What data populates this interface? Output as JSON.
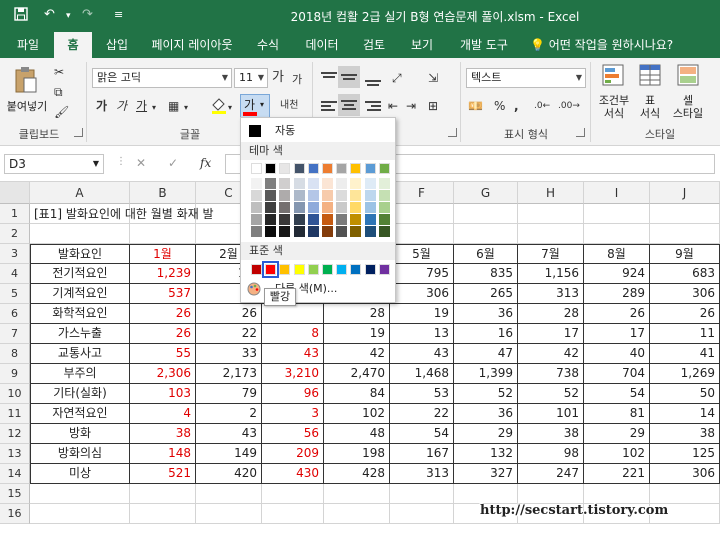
{
  "app": {
    "title": "2018년 컴활 2급 실기 B형 연습문제 풀이.xlsm  -  Excel",
    "brand_color": "#217346"
  },
  "quick_access": {
    "save_icon": "save-icon",
    "undo_icon": "undo-icon",
    "redo_icon": "redo-icon",
    "customize_icon": "customize-icon"
  },
  "tabs": [
    {
      "label": "파일"
    },
    {
      "label": "홈"
    },
    {
      "label": "삽입"
    },
    {
      "label": "페이지 레이아웃"
    },
    {
      "label": "수식"
    },
    {
      "label": "데이터"
    },
    {
      "label": "검토"
    },
    {
      "label": "보기"
    },
    {
      "label": "개발 도구"
    }
  ],
  "tell_me": "어떤 작업을 원하시나요?",
  "ribbon": {
    "clipboard": {
      "paste_label": "붙여넣기",
      "group_label": "클립보드"
    },
    "font": {
      "font_name": "맑은 고딕",
      "font_size": "11",
      "bold": "가",
      "italic": "가",
      "underline": "가",
      "grow": "가",
      "shrink": "가",
      "color_btn": "가",
      "phonetic": "내천",
      "group_label": "글꼴"
    },
    "alignment": {
      "group_label": ""
    },
    "number": {
      "format": "텍스트",
      "group_label": "표시 형식"
    },
    "styles": {
      "conditional": "조건부\n서식",
      "table": "표\n서식",
      "cell": "셀\n스타일",
      "group_label": "스타일"
    }
  },
  "formula_bar": {
    "name_box": "D3",
    "cancel": "✕",
    "enter": "✓",
    "fx": "fx",
    "content": ""
  },
  "columns": [
    "A",
    "B",
    "C",
    "D",
    "E",
    "F",
    "G",
    "H",
    "I",
    "J"
  ],
  "rows": [
    {
      "n": "1",
      "cells": [
        "",
        "",
        "",
        "",
        "",
        "",
        "",
        "",
        "",
        ""
      ]
    },
    {
      "n": "2",
      "cells": [
        "",
        "",
        "",
        "",
        "",
        "",
        "",
        "",
        "",
        ""
      ]
    },
    {
      "n": "3",
      "cells": [
        "발화요인",
        "1월",
        "2월",
        "",
        "",
        "5월",
        "6월",
        "7월",
        "8월",
        "9월"
      ]
    },
    {
      "n": "4",
      "cells": [
        "전기적요인",
        "1,239",
        "1,0",
        "",
        "",
        "795",
        "835",
        "1,156",
        "924",
        "683"
      ]
    },
    {
      "n": "5",
      "cells": [
        "기계적요인",
        "537",
        "3",
        "",
        "",
        "306",
        "265",
        "313",
        "289",
        "306"
      ]
    },
    {
      "n": "6",
      "cells": [
        "화학적요인",
        "26",
        "26",
        "",
        "28",
        "19",
        "36",
        "28",
        "26",
        "26"
      ]
    },
    {
      "n": "7",
      "cells": [
        "가스누출",
        "26",
        "22",
        "8",
        "19",
        "13",
        "16",
        "17",
        "17",
        "11"
      ]
    },
    {
      "n": "8",
      "cells": [
        "교통사고",
        "55",
        "33",
        "43",
        "42",
        "43",
        "47",
        "42",
        "40",
        "41"
      ]
    },
    {
      "n": "9",
      "cells": [
        "부주의",
        "2,306",
        "2,173",
        "3,210",
        "2,470",
        "1,468",
        "1,399",
        "738",
        "704",
        "1,269"
      ]
    },
    {
      "n": "10",
      "cells": [
        "기타(실화)",
        "103",
        "79",
        "96",
        "84",
        "53",
        "52",
        "52",
        "54",
        "50"
      ]
    },
    {
      "n": "11",
      "cells": [
        "자연적요인",
        "4",
        "2",
        "3",
        "102",
        "22",
        "36",
        "101",
        "81",
        "14"
      ]
    },
    {
      "n": "12",
      "cells": [
        "방화",
        "38",
        "43",
        "56",
        "48",
        "54",
        "29",
        "38",
        "29",
        "38"
      ]
    },
    {
      "n": "13",
      "cells": [
        "방화의심",
        "148",
        "149",
        "209",
        "198",
        "167",
        "132",
        "98",
        "102",
        "125"
      ]
    },
    {
      "n": "14",
      "cells": [
        "미상",
        "521",
        "420",
        "430",
        "428",
        "313",
        "327",
        "247",
        "221",
        "306"
      ]
    },
    {
      "n": "15",
      "cells": [
        "",
        "",
        "",
        "",
        "",
        "",
        "",
        "",
        "",
        ""
      ]
    },
    {
      "n": "16",
      "cells": [
        "",
        "",
        "",
        "",
        "",
        "",
        "",
        "",
        "",
        ""
      ]
    }
  ],
  "a1_text": "[표1] 발화요인에 대한 월별 화재 발",
  "red_color": "#e00000",
  "color_dropdown": {
    "automatic": "자동",
    "theme_header": "테마 색",
    "standard_header": "표준 색",
    "more_colors": "다른 색(M)...",
    "tooltip": "빨강",
    "theme_top": [
      "#ffffff",
      "#000000",
      "#e7e6e6",
      "#44546a",
      "#4472c4",
      "#ed7d31",
      "#a5a5a5",
      "#ffc000",
      "#5b9bd5",
      "#70ad47"
    ],
    "theme_shades": [
      [
        "#f2f2f2",
        "#7f7f7f",
        "#d0cece",
        "#d6dce4",
        "#d9e2f3",
        "#fbe5d5",
        "#ededed",
        "#fff2cc",
        "#deebf6",
        "#e2efd9"
      ],
      [
        "#d8d8d8",
        "#595959",
        "#aeabab",
        "#adb9ca",
        "#b4c6e7",
        "#f7cbac",
        "#dbdbdb",
        "#fee599",
        "#bdd7ee",
        "#c5e0b3"
      ],
      [
        "#bfbfbf",
        "#3f3f3f",
        "#757070",
        "#8496b0",
        "#8eaadb",
        "#f4b183",
        "#c9c9c9",
        "#ffd965",
        "#9cc3e5",
        "#a8d08d"
      ],
      [
        "#a5a5a5",
        "#262626",
        "#3a3838",
        "#323f4f",
        "#2f5496",
        "#c55a11",
        "#7b7b7b",
        "#bf8f00",
        "#2e75b5",
        "#538135"
      ],
      [
        "#7f7f7f",
        "#0c0c0c",
        "#171616",
        "#222a35",
        "#1f3864",
        "#833c0b",
        "#525252",
        "#7f6000",
        "#1e4e79",
        "#375623"
      ]
    ],
    "standard": [
      "#c00000",
      "#ff0000",
      "#ffc000",
      "#ffff00",
      "#92d050",
      "#00b050",
      "#00b0f0",
      "#0070c0",
      "#002060",
      "#7030a0"
    ]
  },
  "watermark": "http://secstart.tistory.com"
}
